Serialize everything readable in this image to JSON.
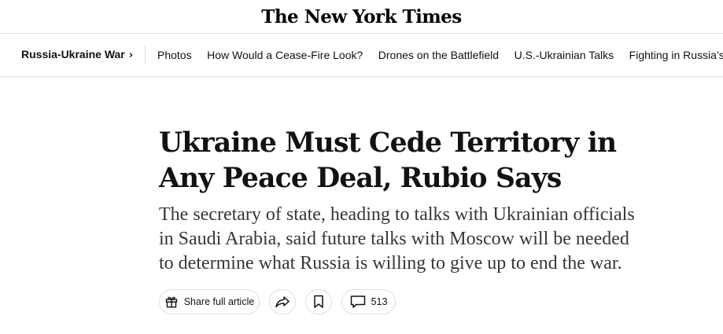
{
  "masthead": {
    "logo_text": "The New York Times"
  },
  "topic_bar": {
    "main_topic": "Russia-Ukraine War",
    "chevron": "›",
    "links": [
      "Photos",
      "How Would a Cease-Fire Look?",
      "Drones on the Battlefield",
      "U.S.-Ukrainian Talks",
      "Fighting in Russia’s Kursk"
    ]
  },
  "article": {
    "headline": "Ukraine Must Cede Territory in Any Peace Deal, Rubio Says",
    "summary": "The secretary of state, heading to talks with Ukrainian officials in Saudi Arabia, said future talks with Moscow will be needed to determine what Russia is willing to give up to end the war."
  },
  "actions": {
    "share_full_article_label": "Share full article",
    "comment_count": "513",
    "icons": {
      "gift": "gift-icon",
      "share": "share-arrow-icon",
      "bookmark": "bookmark-icon",
      "comment": "comment-bubble-icon"
    }
  },
  "colors": {
    "text": "#121212",
    "summary_text": "#363636",
    "border": "#dfdfdf"
  }
}
